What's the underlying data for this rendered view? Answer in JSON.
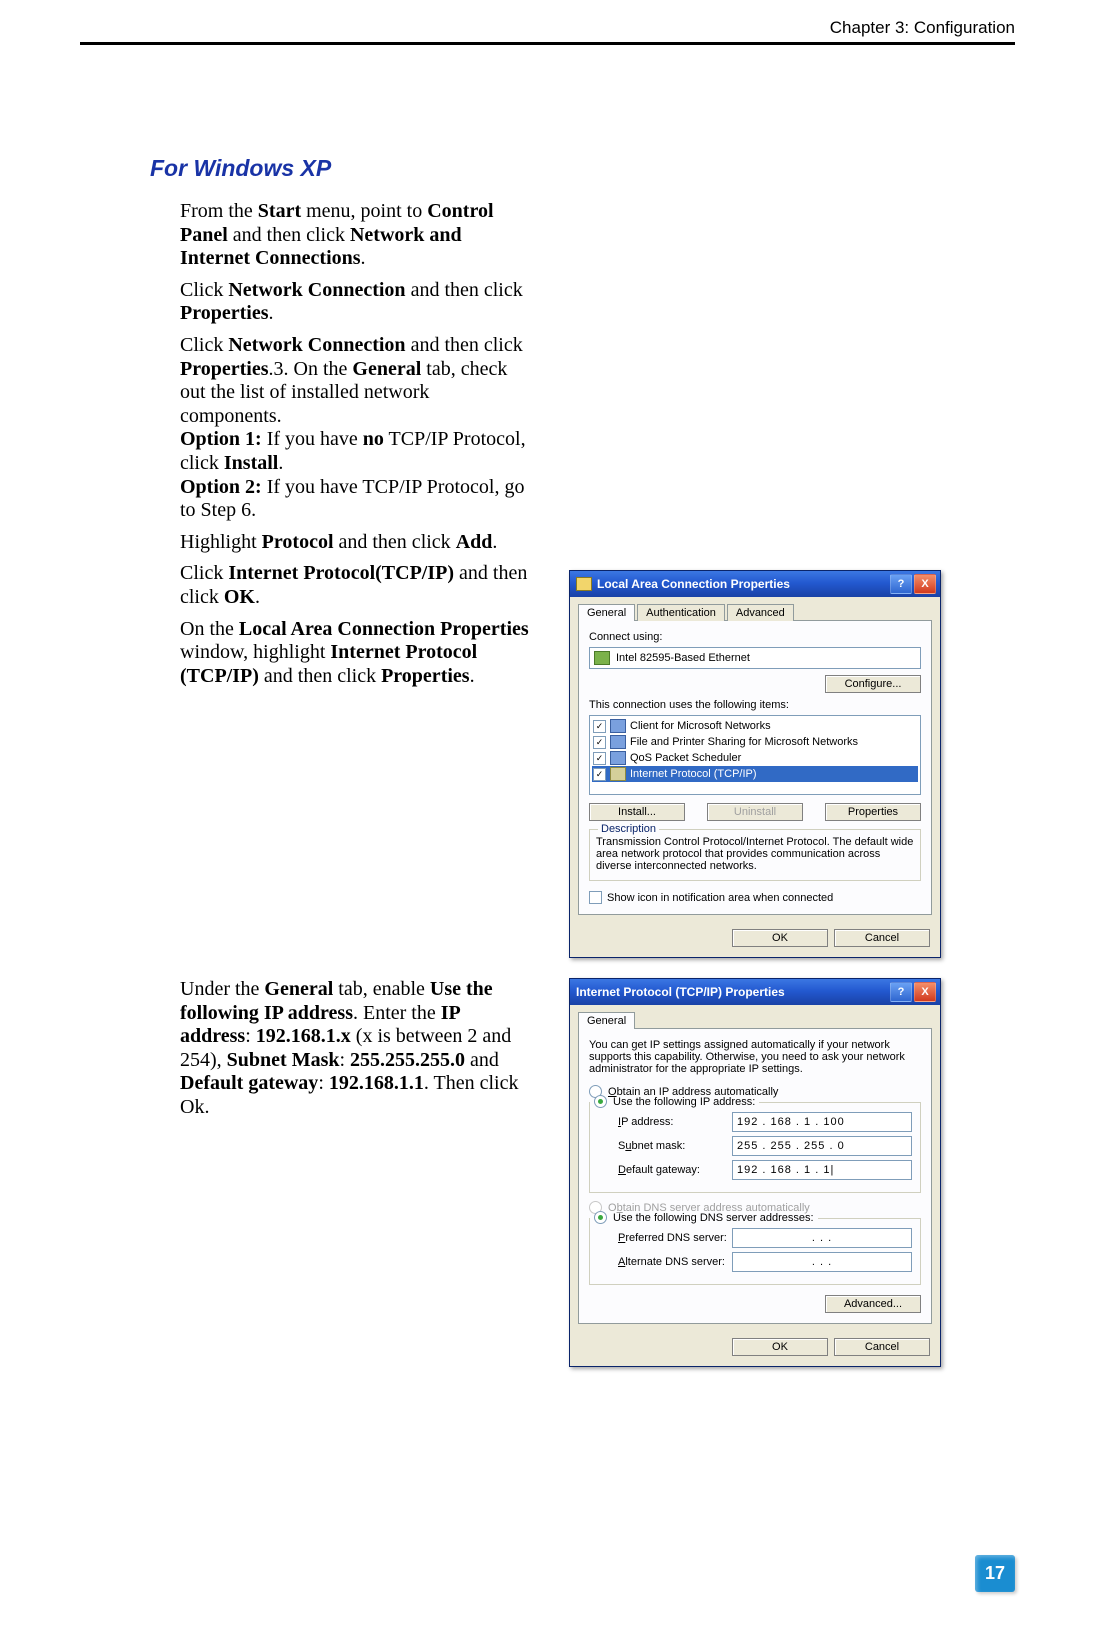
{
  "header": {
    "chapter": "Chapter 3: Configuration"
  },
  "page_number": "17",
  "section": {
    "title": "For Windows XP"
  },
  "paragraphs": {
    "p1_pre": "From the ",
    "p1_b1": "Start",
    "p1_mid1": " menu, point to ",
    "p1_b2": "Control Panel",
    "p1_mid2": " and then click ",
    "p1_b3": "Network and Internet Connections",
    "p2_pre": "Click ",
    "p2_b1": "Network Connection",
    "p2_mid": " and then click ",
    "p2_b2": "Properties",
    "p3_1": "Click ",
    "p3_b1": "Network Connection",
    "p3_2": " and then click ",
    "p3_b2": "Properties",
    "p3_3": ".3. On the ",
    "p3_b3": "General",
    "p3_4": " tab, check out the list of installed network components.",
    "p3_o1a": "Option 1:",
    "p3_o1b": " If you have ",
    "p3_o1c": "no",
    "p3_o1d": " TCP/IP Protocol, click ",
    "p3_o1e": "Install",
    "p3_o2a": "Option 2:",
    "p3_o2b": " If you have TCP/IP Protocol, go to Step 6.",
    "p4_pre": "Highlight ",
    "p4_b1": "Protocol",
    "p4_mid": " and then click ",
    "p4_b2": "Add",
    "p5_pre": "Click ",
    "p5_b1": "Internet Protocol(TCP/IP)",
    "p5_mid": " and then click ",
    "p5_b2": "OK",
    "p6_pre": "On the ",
    "p6_b1": "Local Area Connection Properties",
    "p6_mid1": " window, highlight ",
    "p6_b2": "Internet Protocol (TCP/IP)",
    "p6_mid2": " and then click ",
    "p6_b3": "Properties",
    "p7_pre": "Under the ",
    "p7_b1": "General",
    "p7_mid1": " tab, enable ",
    "p7_b2": "Use the following IP address",
    "p7_mid2": ". Enter the ",
    "p7_b3": "IP address",
    "p7_mid3": ": ",
    "p7_b4": "192.168.1.x",
    "p7_mid4": " (x is between 2 and 254), ",
    "p7_b5": "Subnet Mask",
    "p7_mid5": ": ",
    "p7_b6": "255.255.255.0",
    "p7_mid6": " and ",
    "p7_b7": "Default gateway",
    "p7_mid7": ": ",
    "p7_b8": "192.168.1.1",
    "p7_end": ". Then click Ok."
  },
  "dialog1": {
    "title": "Local Area Connection Properties",
    "tabs": [
      "General",
      "Authentication",
      "Advanced"
    ],
    "connect_label": "Connect using:",
    "adapter": "Intel 82595-Based Ethernet",
    "configure": "Configure...",
    "items_label": "This connection uses the following items:",
    "items": [
      "Client for Microsoft Networks",
      "File and Printer Sharing for Microsoft Networks",
      "QoS Packet Scheduler",
      "Internet Protocol (TCP/IP)"
    ],
    "install": "Install...",
    "uninstall": "Uninstall",
    "properties": "Properties",
    "desc_label": "Description",
    "desc_text": "Transmission Control Protocol/Internet Protocol. The default wide area network protocol that provides communication across diverse interconnected networks.",
    "show_icon": "Show icon in notification area when connected",
    "ok": "OK",
    "cancel": "Cancel"
  },
  "dialog2": {
    "title": "Internet Protocol (TCP/IP) Properties",
    "tab": "General",
    "intro": "You can get IP settings assigned automatically if your network supports this capability. Otherwise, you need to ask your network administrator for the appropriate IP settings.",
    "auto_ip": "Obtain an IP address automatically",
    "use_ip": "Use the following IP address:",
    "ip_label": "IP address:",
    "ip_value": "192 . 168 .   1   . 100",
    "mask_label": "Subnet mask:",
    "mask_value": "255 . 255 . 255 .   0",
    "gw_label": "Default gateway:",
    "gw_value": "192 . 168 .   1   .   1|",
    "auto_dns": "Obtain DNS server address automatically",
    "use_dns": "Use the following DNS server addresses:",
    "pref_dns": "Preferred DNS server:",
    "alt_dns": "Alternate DNS server:",
    "empty_ip": ".       .       .",
    "advanced": "Advanced...",
    "ok": "OK",
    "cancel": "Cancel"
  }
}
